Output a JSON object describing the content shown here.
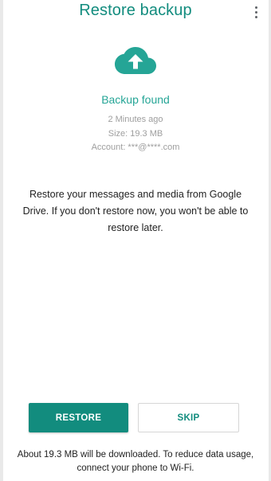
{
  "header": {
    "title": "Restore backup",
    "menu_icon": "more-vert-icon"
  },
  "backup": {
    "icon": "cloud-upload-icon",
    "status": "Backup found",
    "time": "2 Minutes ago",
    "size": "Size: 19.3 MB",
    "account": "Account: ***@****.com"
  },
  "description": "Restore your messages and media from Google Drive. If you don't restore now, you won't be able to restore later.",
  "actions": {
    "restore_label": "RESTORE",
    "skip_label": "SKIP"
  },
  "footer": {
    "note": "About 19.3 MB will be downloaded. To reduce data usage, connect your phone to Wi-Fi."
  },
  "colors": {
    "brand": "#128c7e",
    "accent": "#25a596",
    "muted_text": "#9e9e9e"
  }
}
